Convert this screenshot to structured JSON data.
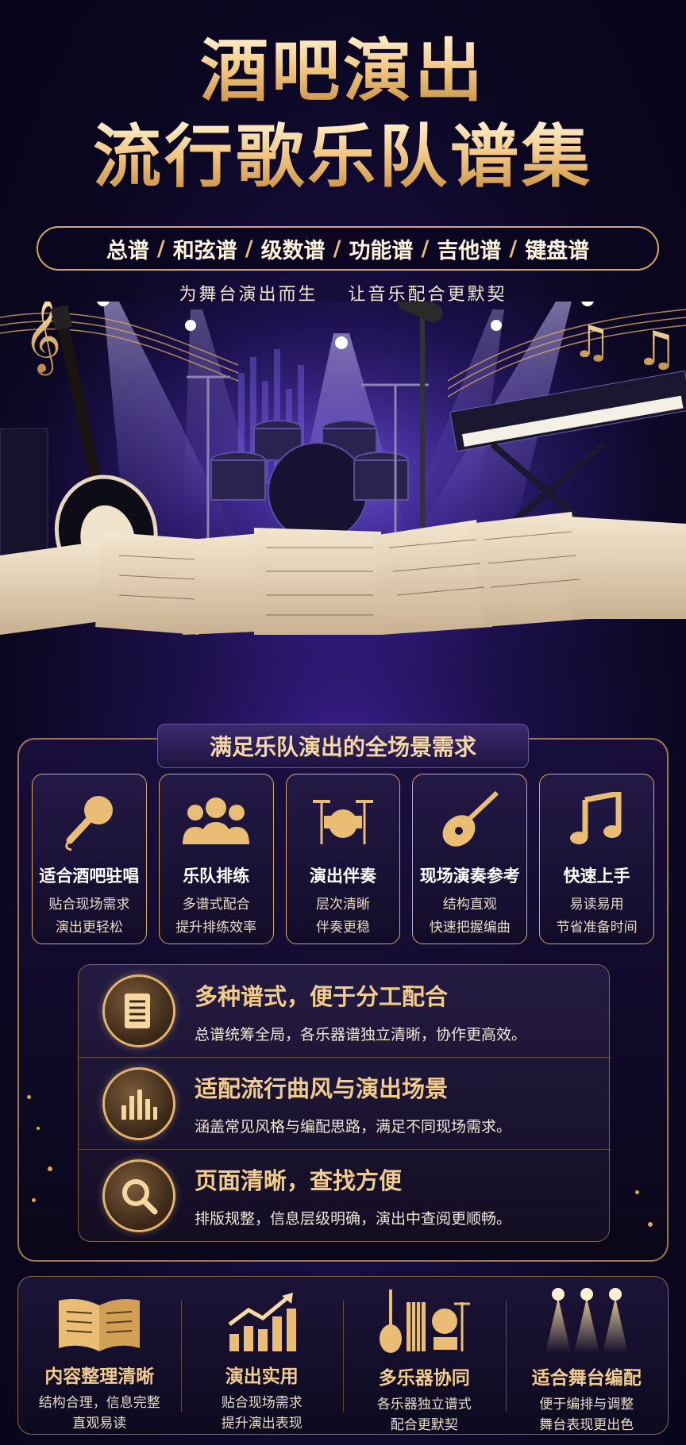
{
  "header": {
    "title_line1": "酒吧演出",
    "title_line2": "流行歌乐队谱集",
    "categories": [
      "总谱",
      "和弦谱",
      "级数谱",
      "功能谱",
      "吉他谱",
      "键盘谱"
    ],
    "separator": "/",
    "tagline_a": "为舞台演出而生",
    "tagline_b": "让音乐配合更默契"
  },
  "section": {
    "heading": "满足乐队演出的全场景需求",
    "cards": [
      {
        "icon": "microphone-icon",
        "title": "适合酒吧驻唱",
        "line1": "贴合现场需求",
        "line2": "演出更轻松"
      },
      {
        "icon": "band-people-icon",
        "title": "乐队排练",
        "line1": "多谱式配合",
        "line2": "提升排练效率"
      },
      {
        "icon": "drum-kit-icon",
        "title": "演出伴奏",
        "line1": "层次清晰",
        "line2": "伴奏更稳"
      },
      {
        "icon": "guitar-icon",
        "title": "现场演奏参考",
        "line1": "结构直观",
        "line2": "快速把握编曲"
      },
      {
        "icon": "music-note-icon",
        "title": "快速上手",
        "line1": "易读易用",
        "line2": "节省准备时间"
      }
    ],
    "features": [
      {
        "icon": "sheet-document-icon",
        "title": "多种谱式，便于分工配合",
        "desc": "总谱统筹全局，各乐器谱独立清晰，协作更高效。"
      },
      {
        "icon": "equalizer-bars-icon",
        "title": "适配流行曲风与演出场景",
        "desc": "涵盖常见风格与编配思路，满足不同现场需求。"
      },
      {
        "icon": "magnifier-icon",
        "title": "页面清晰，查找方便",
        "desc": "排版规整，信息层级明确，演出中查阅更顺畅。"
      }
    ]
  },
  "bottom": [
    {
      "icon": "open-book-icon",
      "title": "内容整理清晰",
      "line1": "结构合理，信息完整",
      "line2": "直观易读"
    },
    {
      "icon": "growth-chart-icon",
      "title": "演出实用",
      "line1": "贴合现场需求",
      "line2": "提升演出表现"
    },
    {
      "icon": "instruments-icon",
      "title": "多乐器协同",
      "line1": "各乐器独立谱式",
      "line2": "配合更默契"
    },
    {
      "icon": "stage-lights-icon",
      "title": "适合舞台编配",
      "line1": "便于编排与调整",
      "line2": "舞台表现更出色"
    }
  ],
  "colors": {
    "gold": "#d8a861",
    "deep_purple": "#1a0f47",
    "accent_violet": "#6b4fd8"
  }
}
